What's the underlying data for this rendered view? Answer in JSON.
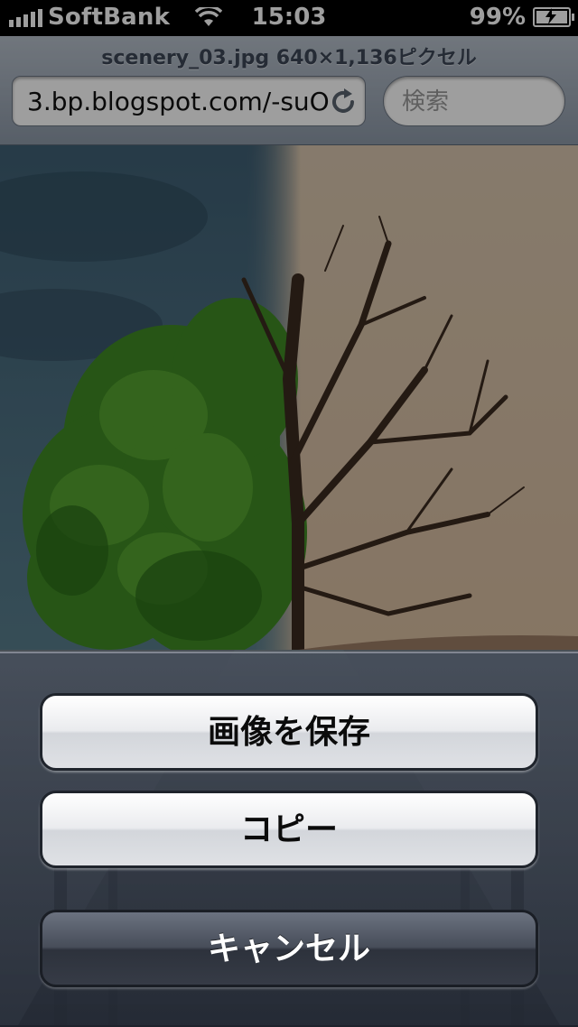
{
  "status_bar": {
    "carrier": "SoftBank",
    "time": "15:03",
    "battery": "99%",
    "icons": [
      "signal-icon",
      "wifi-icon",
      "battery-charging-icon"
    ]
  },
  "browser": {
    "page_title": "scenery_03.jpg 640×1,136ピクセル",
    "url": "3.bp.blogspot.com/-suO",
    "search_placeholder": "検索",
    "icons": [
      "reload-icon"
    ]
  },
  "action_sheet": {
    "save_image": "画像を保存",
    "copy": "コピー",
    "cancel": "キャンセル"
  },
  "colors": {
    "sheet_light_button": "#e6e7ea",
    "sheet_dark_button": "#3b404b",
    "nav_bar": "#a3adba"
  }
}
